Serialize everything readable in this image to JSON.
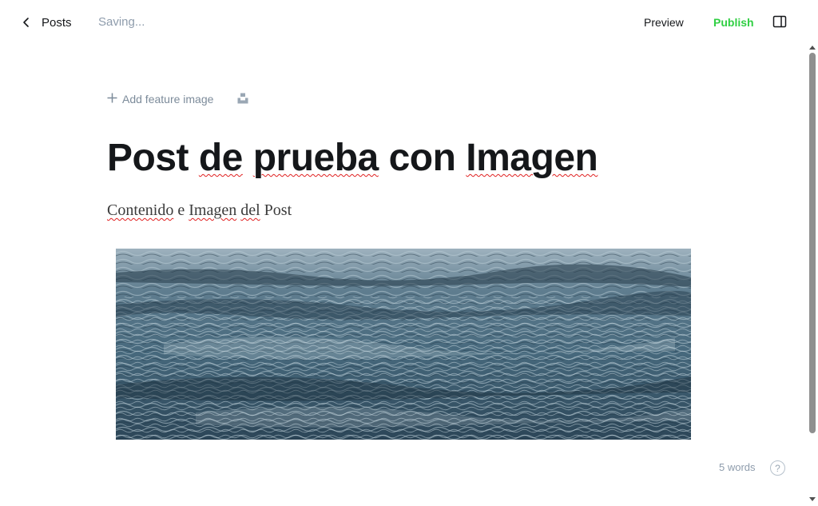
{
  "header": {
    "back_label": "Posts",
    "status": "Saving...",
    "preview_label": "Preview",
    "publish_label": "Publish",
    "publish_color": "#30cf43",
    "sidebar_toggle_icon": "sidebar-panel-icon",
    "back_icon": "chevron-left-icon"
  },
  "editor": {
    "feature_image_label": "Add feature image",
    "feature_image_icon": "plus-icon",
    "unsplash_icon": "unsplash-icon",
    "title_words": [
      "Post",
      "de",
      "prueba",
      "con",
      "Imagen"
    ],
    "body_words": [
      "Contenido",
      "e",
      "Imagen",
      "del",
      "Post"
    ],
    "image_card_icon": "water-photo"
  },
  "footer": {
    "word_count": "5 words",
    "help_icon_label": "?"
  }
}
